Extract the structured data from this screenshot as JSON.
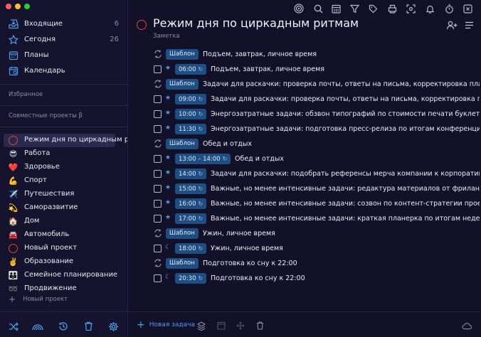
{
  "window": {
    "dot_colors": [
      "#ff5f57",
      "#febc2e",
      "#28c840"
    ]
  },
  "sidebar": {
    "nav": [
      {
        "label": "Входящие",
        "count": "6",
        "icon": "inbox-icon"
      },
      {
        "label": "Сегодня",
        "count": "26",
        "icon": "star-icon"
      },
      {
        "label": "Планы",
        "count": "",
        "icon": "calendar-grid-icon"
      },
      {
        "label": "Календарь",
        "count": "",
        "icon": "calendar-icon"
      }
    ],
    "favorites_label": "Избранное",
    "shared_label": "Совместные проекты β",
    "projects": [
      {
        "label": "Режим дня по циркадным р",
        "icon": "red-ring-icon",
        "emoji": ""
      },
      {
        "label": "Работа",
        "icon": "sunglasses-emoji-icon",
        "emoji": "😎"
      },
      {
        "label": "Здоровье",
        "icon": "heart-emoji-icon",
        "emoji": "❤️"
      },
      {
        "label": "Спорт",
        "icon": "muscle-emoji-icon",
        "emoji": "💪"
      },
      {
        "label": "Путешествия",
        "icon": "airplane-emoji-icon",
        "emoji": "✈️"
      },
      {
        "label": "Саморазвитие",
        "icon": "comet-emoji-icon",
        "emoji": "💫"
      },
      {
        "label": "Дом",
        "icon": "house-emoji-icon",
        "emoji": "🏠"
      },
      {
        "label": "Автомобиль",
        "icon": "car-emoji-icon",
        "emoji": "🚘"
      },
      {
        "label": "Новый проект",
        "icon": "red-ring-icon",
        "emoji": ""
      },
      {
        "label": "Образование",
        "icon": "victory-hand-emoji-icon",
        "emoji": "✌️"
      },
      {
        "label": "Семейное планирование",
        "icon": "family-emoji-icon",
        "emoji": "👪"
      },
      {
        "label": "Продвижение",
        "icon": "rings-emoji-icon",
        "emoji": "➿"
      }
    ],
    "new_project": "Новый проект",
    "bottom_icons": [
      "shuffle-icon",
      "rainbow-icon",
      "history-icon",
      "trash-icon",
      "gear-icon"
    ]
  },
  "toolbar": {
    "icons": [
      "focus-icon",
      "search-icon",
      "calendar-icon",
      "filter-icon",
      "tag-icon",
      "print-icon",
      "screenshot-icon",
      "bell-icon",
      "timer-icon",
      "window-icon"
    ]
  },
  "header": {
    "title": "Режим дня по циркадным ритмам",
    "note": "Заметка",
    "share_icon": "add-person-icon",
    "menu_icon": "menu-icon"
  },
  "tasks": [
    {
      "kind": "template",
      "badge": "Шаблон",
      "text": "Подъем, завтрак, личное время"
    },
    {
      "kind": "task",
      "mark": "star",
      "badge": "06:00",
      "text": "Подъем, завтрак, личное время"
    },
    {
      "kind": "template",
      "badge": "Шаблон",
      "text": "Задачи для раскачки: проверка почты, ответы на письма, корректировка плана"
    },
    {
      "kind": "task",
      "mark": "star",
      "badge": "09:00",
      "text": "Задачи для раскачки: проверка почты, ответы на письма, корректировка пла"
    },
    {
      "kind": "task",
      "mark": "star",
      "badge": "10:00",
      "text": "Энергозатратные задачи: обзвон типографий по стоимости печати буклетов (м"
    },
    {
      "kind": "task",
      "mark": "star",
      "badge": "11:30",
      "text": "Энергозатратные задачи: подготовка пресс-релиза по итогам конференции Сп"
    },
    {
      "kind": "template",
      "badge": "Шаблон",
      "text": "Обед и отдых"
    },
    {
      "kind": "task",
      "mark": "star",
      "badge": "13:00 – 14:00",
      "text": "Обед и отдых"
    },
    {
      "kind": "task",
      "mark": "star",
      "badge": "14:00",
      "text": "Задачи для раскачки: подобрать референсы мерча компании к корпоративу"
    },
    {
      "kind": "task",
      "mark": "star",
      "badge": "15:00",
      "text": "Важные, но менее интенсивные задачи: редактура материалов от фрилансеро"
    },
    {
      "kind": "task",
      "mark": "star",
      "badge": "16:00",
      "text": "Важные, но менее интенсивные задачи: созвон по контент-стратегии проекта С"
    },
    {
      "kind": "task",
      "mark": "star",
      "badge": "17:00",
      "text": "Важные, но менее интенсивные задачи: краткая планерка по итогам недели - ч"
    },
    {
      "kind": "template",
      "badge": "Шаблон",
      "text": "Ужин, личное время"
    },
    {
      "kind": "task",
      "mark": "moon",
      "badge": "18:00",
      "text": "Ужин, личное время"
    },
    {
      "kind": "template",
      "badge": "Шаблон",
      "text": "Подготовка ко сну к 22:00"
    },
    {
      "kind": "task",
      "mark": "moon",
      "badge": "20:30",
      "text": "Подготовка ко сну к 22:00"
    }
  ],
  "footer": {
    "new_task": "Новая задача",
    "icons": [
      "layers-icon",
      "calendar-icon",
      "move-icon",
      "trash-icon"
    ],
    "cloud_icon": "cloud-icon"
  },
  "colors": {
    "accent": "#4a9ee8",
    "badge": "#1f4f82",
    "project_ring": "#e0452a"
  }
}
